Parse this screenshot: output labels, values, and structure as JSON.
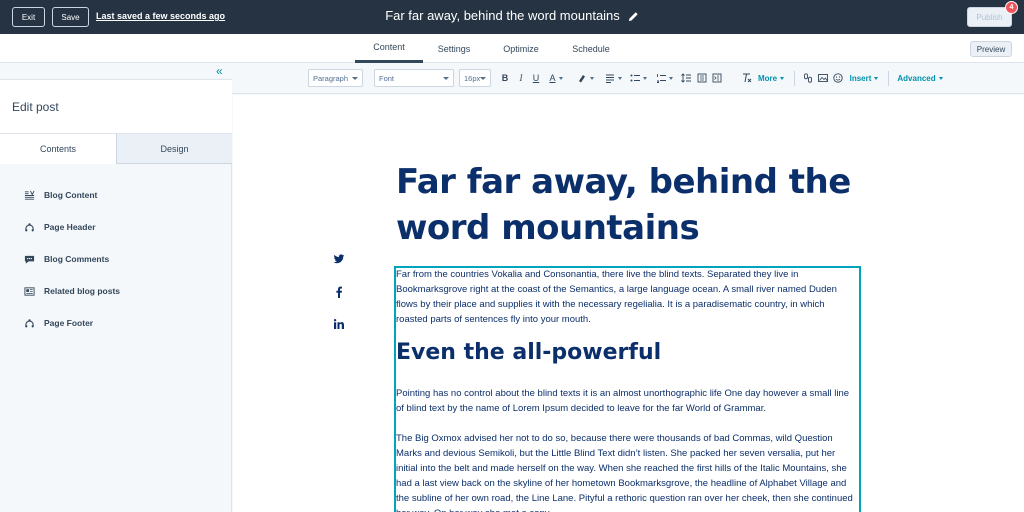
{
  "topbar": {
    "exit_label": "Exit",
    "save_label": "Save",
    "last_saved": "Last saved a few seconds ago",
    "post_title": "Far far away, behind the word mountains",
    "publish_label": "Publish",
    "notification_count": "4"
  },
  "tabs": {
    "content": "Content",
    "settings": "Settings",
    "optimize": "Optimize",
    "schedule": "Schedule",
    "active": "Content",
    "preview_label": "Preview"
  },
  "sidebar": {
    "title": "Edit post",
    "tab_contents": "Contents",
    "tab_design": "Design",
    "items": [
      {
        "label": "Blog Content",
        "icon": "text-align-icon"
      },
      {
        "label": "Page Header",
        "icon": "module-icon"
      },
      {
        "label": "Blog Comments",
        "icon": "comments-icon"
      },
      {
        "label": "Related blog posts",
        "icon": "newspaper-icon"
      },
      {
        "label": "Page Footer",
        "icon": "module-icon"
      }
    ]
  },
  "toolbar": {
    "paragraph_select": "Paragraph",
    "font_select": "Font",
    "size_select": "16px",
    "more_label": "More",
    "insert_label": "Insert",
    "advanced_label": "Advanced"
  },
  "content": {
    "heading": "Far far away, behind the word mountains",
    "p1": "Far from the countries Vokalia and Consonantia, there live the blind texts. Separated they live in Bookmarksgrove right at the coast of the Semantics, a large language ocean. A small river named Duden flows by their place and supplies it with the necessary regelialia. It is a paradisematic country, in which roasted parts of sentences fly into your mouth.",
    "subheading": "Even the all-powerful",
    "p2": "Pointing has no control about the blind texts it is an almost unorthographic life One day however a small line of blind text by the name of Lorem Ipsum decided to leave for the far World of Grammar.",
    "p3": "The Big Oxmox advised her not to do so, because there were thousands of bad Commas, wild Question Marks and devious Semikoli, but the Little Blind Text didn’t listen. She packed her seven versalia, put her initial into the belt and made herself on the way. When she reached the first hills of the Italic Mountains, she had a last view back on the skyline of her hometown Bookmarksgrove, the headline of Alphabet Village and the subline of her own road, the Line Lane. Pityful a rethoric question ran over her cheek, then she continued her way. On her way she met a copy."
  },
  "colors": {
    "topbar_bg": "#253342",
    "heading_text": "#0b2f6b",
    "selection_border": "#00a4bd",
    "link_accent": "#0091ae",
    "badge": "#f2545b"
  }
}
